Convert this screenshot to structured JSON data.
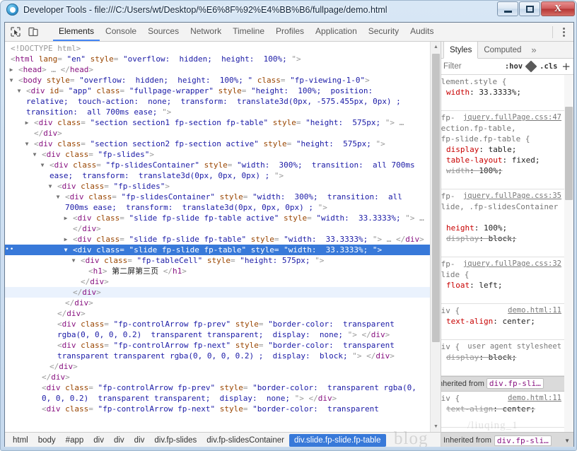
{
  "window": {
    "title": "Developer Tools - file:///C:/Users/wt/Desktop/%E6%8F%92%E4%BB%B6/fullpage/demo.html",
    "logo_icon": "chrome-logo-icon",
    "minimize_label": "–",
    "maximize_label": "□",
    "close_label": "✕"
  },
  "toolbar": {
    "inspect_icon": "inspect-element-icon",
    "device_icon": "toggle-device-toolbar-icon",
    "menu_icon": "kebab-menu-icon",
    "tabs": [
      {
        "label": "Elements",
        "active": true
      },
      {
        "label": "Console",
        "active": false
      },
      {
        "label": "Sources",
        "active": false
      },
      {
        "label": "Network",
        "active": false
      },
      {
        "label": "Timeline",
        "active": false
      },
      {
        "label": "Profiles",
        "active": false
      },
      {
        "label": "Application",
        "active": false
      },
      {
        "label": "Security",
        "active": false
      },
      {
        "label": "Audits",
        "active": false
      }
    ]
  },
  "dom": {
    "lines": [
      {
        "id": "l0",
        "indent": 0,
        "twisty": "none",
        "html": "<span class=\"dt\">&lt;!DOCTYPE html&gt;</span>"
      },
      {
        "id": "l1",
        "indent": 0,
        "twisty": "none",
        "html": "<span class=\"pun\">&lt;</span><span class=\"tag\">html</span> <span class=\"attr\">lang</span><span class=\"pun\">=</span> <span class=\"val\">\"en\"</span> <span class=\"attr\">style</span><span class=\"pun\">=</span> <span class=\"val\">\"overflow:&nbsp; hidden;&nbsp; height:&nbsp; 100%;&nbsp;</span><span class=\"pun\">\"&gt;</span>"
      },
      {
        "id": "l2",
        "indent": 1,
        "twisty": "closed",
        "html": "<span class=\"pun\">&lt;</span><span class=\"tag\">head</span><span class=\"pun\">&gt;</span> <span class=\"ellip\">…</span> <span class=\"pun\">&lt;/</span><span class=\"tag\">head</span><span class=\"pun\">&gt;</span>"
      },
      {
        "id": "l3",
        "indent": 1,
        "twisty": "open",
        "html": "<span class=\"pun\">&lt;</span><span class=\"tag\">body</span> <span class=\"attr\">style</span><span class=\"pun\">=</span> <span class=\"val\">\"overflow:&nbsp; hidden;&nbsp; height:&nbsp; 100%;&nbsp;\"</span> <span class=\"attr\">class</span><span class=\"pun\">=</span> <span class=\"val\">\"fp-viewing-1-0\"</span><span class=\"pun\">&gt;</span>"
      },
      {
        "id": "l4",
        "indent": 2,
        "twisty": "open",
        "html": "<span class=\"pun\">&lt;</span><span class=\"tag\">div</span> <span class=\"attr\">id</span><span class=\"pun\">=</span> <span class=\"val\">\"app\"</span> <span class=\"attr\">class</span><span class=\"pun\">=</span> <span class=\"val\">\"fullpage-wrapper\"</span> <span class=\"attr\">style</span><span class=\"pun\">=</span> <span class=\"val\">\"height:&nbsp; 100%;&nbsp; position:&nbsp; relative;&nbsp; touch-action:&nbsp; none;&nbsp; transform:&nbsp; translate3d(0px, -575.455px, 0px) ;&nbsp; transition:&nbsp; all 700ms ease;&nbsp;</span><span class=\"pun\">\"&gt;</span>"
      },
      {
        "id": "l5",
        "indent": 3,
        "twisty": "closed",
        "html": "<span class=\"pun\">&lt;</span><span class=\"tag\">div</span> <span class=\"attr\">class</span><span class=\"pun\">=</span> <span class=\"val\">\"section section1 fp-section fp-table\"</span> <span class=\"attr\">style</span><span class=\"pun\">=</span> <span class=\"val\">\"height:&nbsp; 575px;&nbsp;</span><span class=\"pun\">\"&gt;</span> <span class=\"ellip\">…</span> <span class=\"pun\">&lt;/</span><span class=\"tag\">div</span><span class=\"pun\">&gt;</span>"
      },
      {
        "id": "l6",
        "indent": 3,
        "twisty": "open",
        "html": "<span class=\"pun\">&lt;</span><span class=\"tag\">div</span> <span class=\"attr\">class</span><span class=\"pun\">=</span> <span class=\"val\">\"section section2 fp-section active\"</span> <span class=\"attr\">style</span><span class=\"pun\">=</span> <span class=\"val\">\"height:&nbsp; 575px;&nbsp;</span><span class=\"pun\">\"&gt;</span>"
      },
      {
        "id": "l7",
        "indent": 4,
        "twisty": "open",
        "html": "<span class=\"pun\">&lt;</span><span class=\"tag\">div</span> <span class=\"attr\">class</span><span class=\"pun\">=</span> <span class=\"val\">\"fp-slides\"</span><span class=\"pun\">&gt;</span>"
      },
      {
        "id": "l8",
        "indent": 5,
        "twisty": "open",
        "html": "<span class=\"pun\">&lt;</span><span class=\"tag\">div</span> <span class=\"attr\">class</span><span class=\"pun\">=</span> <span class=\"val\">\"fp-slidesContainer\"</span> <span class=\"attr\">style</span><span class=\"pun\">=</span> <span class=\"val\">\"width:&nbsp; 300%;&nbsp; transition:&nbsp; all 700ms ease;&nbsp; transform:&nbsp; translate3d(0px, 0px, 0px) ;&nbsp;</span><span class=\"pun\">\"&gt;</span>"
      },
      {
        "id": "l9",
        "indent": 6,
        "twisty": "open",
        "html": "<span class=\"pun\">&lt;</span><span class=\"tag\">div</span> <span class=\"attr\">class</span><span class=\"pun\">=</span> <span class=\"val\">\"fp-slides\"</span><span class=\"pun\">&gt;</span>"
      },
      {
        "id": "l10",
        "indent": 7,
        "twisty": "open",
        "html": "<span class=\"pun\">&lt;</span><span class=\"tag\">div</span> <span class=\"attr\">class</span><span class=\"pun\">=</span> <span class=\"val\">\"fp-slidesContainer\"</span> <span class=\"attr\">style</span><span class=\"pun\">=</span> <span class=\"val\">\"width:&nbsp; 300%;&nbsp; transition:&nbsp; all 700ms ease;&nbsp; transform:&nbsp; translate3d(0px, 0px, 0px) ;&nbsp;</span><span class=\"pun\">\"&gt;</span>"
      },
      {
        "id": "l11",
        "indent": 8,
        "twisty": "closed",
        "html": "<span class=\"pun\">&lt;</span><span class=\"tag\">div</span> <span class=\"attr\">class</span><span class=\"pun\">=</span> <span class=\"val\">\"slide fp-slide fp-table active\"</span> <span class=\"attr\">style</span><span class=\"pun\">=</span> <span class=\"val\">\"width:&nbsp; 33.3333%;&nbsp;</span><span class=\"pun\">\"&gt;</span> <span class=\"ellip\">…</span> <span class=\"pun\">&lt;/</span><span class=\"tag\">div</span><span class=\"pun\">&gt;</span>"
      },
      {
        "id": "l12",
        "indent": 8,
        "twisty": "closed",
        "html": "<span class=\"pun\">&lt;</span><span class=\"tag\">div</span> <span class=\"attr\">class</span><span class=\"pun\">=</span> <span class=\"val\">\"slide fp-slide fp-table\"</span> <span class=\"attr\">style</span><span class=\"pun\">=</span> <span class=\"val\">\"width:&nbsp; 33.3333%;&nbsp;</span><span class=\"pun\">\"&gt;</span> <span class=\"ellip\">…</span> <span class=\"pun\">&lt;/</span><span class=\"tag\">div</span><span class=\"pun\">&gt;</span>"
      },
      {
        "id": "l13",
        "indent": 8,
        "twisty": "open",
        "selected": true,
        "html": "<span class=\"pun\">&lt;</span><span class=\"tag\">div</span> <span class=\"attr\">class</span><span class=\"pun\">=</span> <span class=\"val\">\"slide fp-slide fp-table\"</span> <span class=\"attr\">style</span><span class=\"pun\">=</span> <span class=\"val\">\"width:&nbsp; 33.3333%;&nbsp;</span><span class=\"pun\">\"&gt;</span>"
      },
      {
        "id": "l14",
        "indent": 9,
        "twisty": "open",
        "html": "<span class=\"pun\">&lt;</span><span class=\"tag\">div</span> <span class=\"attr\">class</span><span class=\"pun\">=</span> <span class=\"val\">\"fp-tableCell\"</span> <span class=\"attr\">style</span><span class=\"pun\">=</span> <span class=\"val\">\"height: 575px;&nbsp;</span><span class=\"pun\">\"&gt;</span>"
      },
      {
        "id": "l15",
        "indent": 10,
        "twisty": "none",
        "html": "<span class=\"pun\">&lt;</span><span class=\"tag\">h1</span><span class=\"pun\">&gt;</span> <span class=\"txt\">第二屏第三页</span> <span class=\"pun\">&lt;/</span><span class=\"tag\">h1</span><span class=\"pun\">&gt;</span>"
      },
      {
        "id": "l16",
        "indent": 9,
        "twisty": "none",
        "html": "<span class=\"pun\">&lt;/</span><span class=\"tag\">div</span><span class=\"pun\">&gt;</span>"
      },
      {
        "id": "l17",
        "indent": 8,
        "twisty": "none",
        "highlight": true,
        "html": "<span class=\"pun\">&lt;/</span><span class=\"tag\">div</span><span class=\"pun\">&gt;</span>"
      },
      {
        "id": "l18",
        "indent": 7,
        "twisty": "none",
        "html": "<span class=\"pun\">&lt;/</span><span class=\"tag\">div</span><span class=\"pun\">&gt;</span>"
      },
      {
        "id": "l19",
        "indent": 6,
        "twisty": "none",
        "html": "<span class=\"pun\">&lt;/</span><span class=\"tag\">div</span><span class=\"pun\">&gt;</span>"
      },
      {
        "id": "l20",
        "indent": 6,
        "twisty": "none",
        "html": "<span class=\"pun\">&lt;</span><span class=\"tag\">div</span> <span class=\"attr\">class</span><span class=\"pun\">=</span> <span class=\"val\">\"fp-controlArrow fp-prev\"</span> <span class=\"attr\">style</span><span class=\"pun\">=</span> <span class=\"val\">\"border-color:&nbsp; transparent rgba(0, 0, 0, 0.2)&nbsp; transparent transparent;&nbsp; display:&nbsp; none;&nbsp;</span><span class=\"pun\">\"&gt;</span> <span class=\"pun\">&lt;/</span><span class=\"tag\">div</span><span class=\"pun\">&gt;</span>"
      },
      {
        "id": "l21",
        "indent": 6,
        "twisty": "none",
        "html": "<span class=\"pun\">&lt;</span><span class=\"tag\">div</span> <span class=\"attr\">class</span><span class=\"pun\">=</span> <span class=\"val\">\"fp-controlArrow fp-next\"</span> <span class=\"attr\">style</span><span class=\"pun\">=</span> <span class=\"val\">\"border-color:&nbsp; transparent transparent transparent rgba(0, 0, 0, 0.2) ;&nbsp; display:&nbsp; block;&nbsp;</span><span class=\"pun\">\"&gt;</span> <span class=\"pun\">&lt;/</span><span class=\"tag\">div</span><span class=\"pun\">&gt;</span>"
      },
      {
        "id": "l22",
        "indent": 5,
        "twisty": "none",
        "html": "<span class=\"pun\">&lt;/</span><span class=\"tag\">div</span><span class=\"pun\">&gt;</span>"
      },
      {
        "id": "l23",
        "indent": 4,
        "twisty": "none",
        "html": "<span class=\"pun\">&lt;/</span><span class=\"tag\">div</span><span class=\"pun\">&gt;</span>"
      },
      {
        "id": "l24",
        "indent": 4,
        "twisty": "none",
        "html": "<span class=\"pun\">&lt;</span><span class=\"tag\">div</span> <span class=\"attr\">class</span><span class=\"pun\">=</span> <span class=\"val\">\"fp-controlArrow fp-prev\"</span> <span class=\"attr\">style</span><span class=\"pun\">=</span> <span class=\"val\">\"border-color:&nbsp; transparent rgba(0, 0, 0, 0.2)&nbsp; transparent transparent;&nbsp; display:&nbsp; none;&nbsp;</span><span class=\"pun\">\"&gt;</span> <span class=\"pun\">&lt;/</span><span class=\"tag\">div</span><span class=\"pun\">&gt;</span>"
      },
      {
        "id": "l25",
        "indent": 4,
        "twisty": "none",
        "html": "<span class=\"pun\">&lt;</span><span class=\"tag\">div</span> <span class=\"attr\">class</span><span class=\"pun\">=</span> <span class=\"val\">\"fp-controlArrow fp-next\"</span> <span class=\"attr\">style</span><span class=\"pun\">=</span> <span class=\"val\">\"border-color:&nbsp; transparent</span>"
      }
    ],
    "breadcrumb": [
      {
        "label": "html",
        "active": false
      },
      {
        "label": "body",
        "active": false
      },
      {
        "label": "#app",
        "active": false
      },
      {
        "label": "div",
        "active": false
      },
      {
        "label": "div",
        "active": false
      },
      {
        "label": "div",
        "active": false
      },
      {
        "label": "div.fp-slides",
        "active": false
      },
      {
        "label": "div.fp-slidesContainer",
        "active": false
      },
      {
        "label": "div.slide.fp-slide.fp-table",
        "active": true
      }
    ]
  },
  "styles": {
    "tabs": [
      {
        "label": "Styles",
        "active": true
      },
      {
        "label": "Computed",
        "active": false
      },
      {
        "label": "»",
        "active": false
      }
    ],
    "filter_placeholder": "Filter",
    "hov_label": ":hov",
    "cls_label": ".cls",
    "plus_label": "+",
    "diamond_icon": "color-picker-icon",
    "rules": [
      {
        "selector": "element.style {",
        "origin": "",
        "declarations": [
          {
            "name": "width",
            "value": "33.3333%;",
            "disabled": false
          }
        ]
      },
      {
        "selector": ".fp-section.fp-table,\n.fp-slide.fp-table {",
        "origin": "jquery.fullPage.css:47",
        "declarations": [
          {
            "name": "display",
            "value": "table;",
            "disabled": false
          },
          {
            "name": "table-layout",
            "value": "fixed;",
            "disabled": false
          },
          {
            "name": "width",
            "value": "100%;",
            "disabled": true
          }
        ]
      },
      {
        "selector": ".fp-slide, .fp-slidesContainer {",
        "origin": "jquery.fullPage.css:35",
        "declarations": [
          {
            "name": "height",
            "value": "100%;",
            "disabled": false
          },
          {
            "name": "display",
            "value": "block;",
            "disabled": true
          }
        ]
      },
      {
        "selector": ".fp-slide {",
        "origin": "jquery.fullPage.css:32",
        "declarations": [
          {
            "name": "float",
            "value": "left;",
            "disabled": false
          }
        ]
      },
      {
        "selector": "div {",
        "origin": "demo.html:11",
        "declarations": [
          {
            "name": "text-align",
            "value": "center;",
            "disabled": false
          }
        ]
      },
      {
        "selector": "div {",
        "origin": "user agent stylesheet",
        "origin_plain": true,
        "declarations": [
          {
            "name": "display",
            "value": "block;",
            "disabled": true
          }
        ]
      }
    ],
    "inherited_label": "Inherited from",
    "inherited_element": "div.fp-sli…",
    "inherited_rule": {
      "selector": "div {",
      "origin": "demo.html:11",
      "declarations": [
        {
          "name": "text-align",
          "value": "center;",
          "disabled": true
        }
      ]
    },
    "footer_label": "Inherited from",
    "footer_element": "div.fp-sli…"
  },
  "watermark": {
    "text": "blog",
    "text2": "/liuqing_1"
  }
}
